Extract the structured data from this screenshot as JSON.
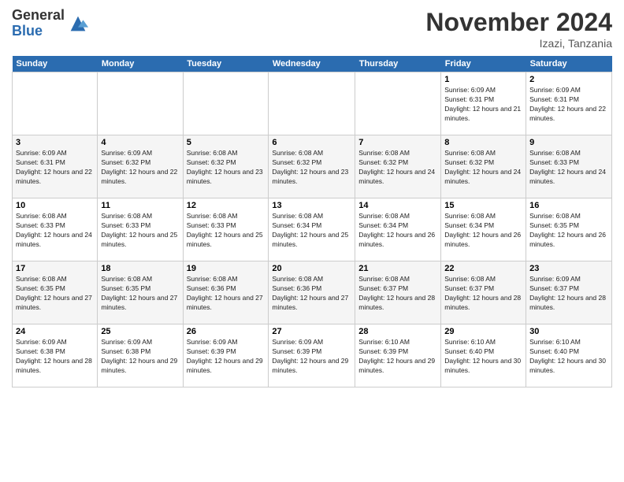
{
  "logo": {
    "general": "General",
    "blue": "Blue"
  },
  "title": "November 2024",
  "location": "Izazi, Tanzania",
  "days_header": [
    "Sunday",
    "Monday",
    "Tuesday",
    "Wednesday",
    "Thursday",
    "Friday",
    "Saturday"
  ],
  "weeks": [
    [
      {
        "day": "",
        "text": ""
      },
      {
        "day": "",
        "text": ""
      },
      {
        "day": "",
        "text": ""
      },
      {
        "day": "",
        "text": ""
      },
      {
        "day": "",
        "text": ""
      },
      {
        "day": "1",
        "text": "Sunrise: 6:09 AM\nSunset: 6:31 PM\nDaylight: 12 hours and 21 minutes."
      },
      {
        "day": "2",
        "text": "Sunrise: 6:09 AM\nSunset: 6:31 PM\nDaylight: 12 hours and 22 minutes."
      }
    ],
    [
      {
        "day": "3",
        "text": "Sunrise: 6:09 AM\nSunset: 6:31 PM\nDaylight: 12 hours and 22 minutes."
      },
      {
        "day": "4",
        "text": "Sunrise: 6:09 AM\nSunset: 6:32 PM\nDaylight: 12 hours and 22 minutes."
      },
      {
        "day": "5",
        "text": "Sunrise: 6:08 AM\nSunset: 6:32 PM\nDaylight: 12 hours and 23 minutes."
      },
      {
        "day": "6",
        "text": "Sunrise: 6:08 AM\nSunset: 6:32 PM\nDaylight: 12 hours and 23 minutes."
      },
      {
        "day": "7",
        "text": "Sunrise: 6:08 AM\nSunset: 6:32 PM\nDaylight: 12 hours and 24 minutes."
      },
      {
        "day": "8",
        "text": "Sunrise: 6:08 AM\nSunset: 6:32 PM\nDaylight: 12 hours and 24 minutes."
      },
      {
        "day": "9",
        "text": "Sunrise: 6:08 AM\nSunset: 6:33 PM\nDaylight: 12 hours and 24 minutes."
      }
    ],
    [
      {
        "day": "10",
        "text": "Sunrise: 6:08 AM\nSunset: 6:33 PM\nDaylight: 12 hours and 24 minutes."
      },
      {
        "day": "11",
        "text": "Sunrise: 6:08 AM\nSunset: 6:33 PM\nDaylight: 12 hours and 25 minutes."
      },
      {
        "day": "12",
        "text": "Sunrise: 6:08 AM\nSunset: 6:33 PM\nDaylight: 12 hours and 25 minutes."
      },
      {
        "day": "13",
        "text": "Sunrise: 6:08 AM\nSunset: 6:34 PM\nDaylight: 12 hours and 25 minutes."
      },
      {
        "day": "14",
        "text": "Sunrise: 6:08 AM\nSunset: 6:34 PM\nDaylight: 12 hours and 26 minutes."
      },
      {
        "day": "15",
        "text": "Sunrise: 6:08 AM\nSunset: 6:34 PM\nDaylight: 12 hours and 26 minutes."
      },
      {
        "day": "16",
        "text": "Sunrise: 6:08 AM\nSunset: 6:35 PM\nDaylight: 12 hours and 26 minutes."
      }
    ],
    [
      {
        "day": "17",
        "text": "Sunrise: 6:08 AM\nSunset: 6:35 PM\nDaylight: 12 hours and 27 minutes."
      },
      {
        "day": "18",
        "text": "Sunrise: 6:08 AM\nSunset: 6:35 PM\nDaylight: 12 hours and 27 minutes."
      },
      {
        "day": "19",
        "text": "Sunrise: 6:08 AM\nSunset: 6:36 PM\nDaylight: 12 hours and 27 minutes."
      },
      {
        "day": "20",
        "text": "Sunrise: 6:08 AM\nSunset: 6:36 PM\nDaylight: 12 hours and 27 minutes."
      },
      {
        "day": "21",
        "text": "Sunrise: 6:08 AM\nSunset: 6:37 PM\nDaylight: 12 hours and 28 minutes."
      },
      {
        "day": "22",
        "text": "Sunrise: 6:08 AM\nSunset: 6:37 PM\nDaylight: 12 hours and 28 minutes."
      },
      {
        "day": "23",
        "text": "Sunrise: 6:09 AM\nSunset: 6:37 PM\nDaylight: 12 hours and 28 minutes."
      }
    ],
    [
      {
        "day": "24",
        "text": "Sunrise: 6:09 AM\nSunset: 6:38 PM\nDaylight: 12 hours and 28 minutes."
      },
      {
        "day": "25",
        "text": "Sunrise: 6:09 AM\nSunset: 6:38 PM\nDaylight: 12 hours and 29 minutes."
      },
      {
        "day": "26",
        "text": "Sunrise: 6:09 AM\nSunset: 6:39 PM\nDaylight: 12 hours and 29 minutes."
      },
      {
        "day": "27",
        "text": "Sunrise: 6:09 AM\nSunset: 6:39 PM\nDaylight: 12 hours and 29 minutes."
      },
      {
        "day": "28",
        "text": "Sunrise: 6:10 AM\nSunset: 6:39 PM\nDaylight: 12 hours and 29 minutes."
      },
      {
        "day": "29",
        "text": "Sunrise: 6:10 AM\nSunset: 6:40 PM\nDaylight: 12 hours and 30 minutes."
      },
      {
        "day": "30",
        "text": "Sunrise: 6:10 AM\nSunset: 6:40 PM\nDaylight: 12 hours and 30 minutes."
      }
    ]
  ]
}
